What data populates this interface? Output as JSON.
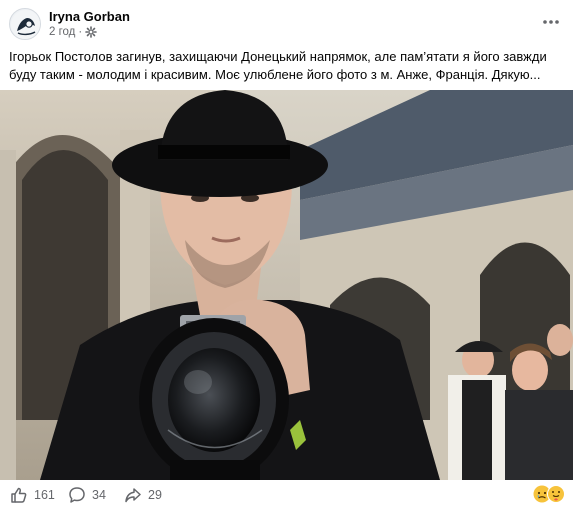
{
  "post": {
    "author": "Iryna Gorban",
    "time": "2 год",
    "text": "Ігорьок Постолов загинув, захищаючи Донецький напрямок, але пам’ятати я його завжди буду таким - молодим і красивим. Моє улюблене його фото з м. Анже, Франція. Дякую..."
  },
  "stats": {
    "likes": "161",
    "comments": "34",
    "shares": "29"
  },
  "icons": {
    "like": "thumbs-up-icon",
    "comment": "speech-bubble-icon",
    "share": "share-arrow-icon",
    "audience": "gear-icon",
    "more": "ellipsis-icon"
  },
  "colors": {
    "meta_text": "#65676b",
    "text": "#050505"
  }
}
